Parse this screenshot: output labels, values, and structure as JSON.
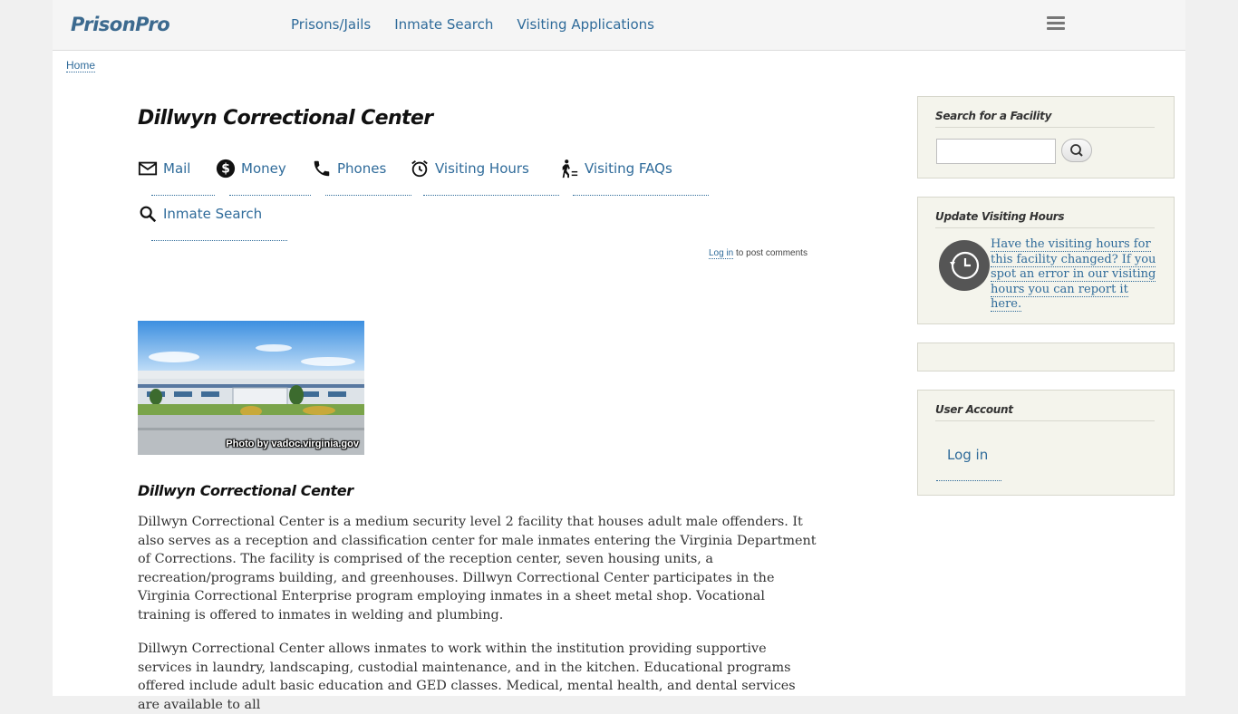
{
  "header": {
    "logo": "PrisonPro",
    "nav": [
      "Prisons/Jails",
      "Inmate Search",
      "Visiting Applications"
    ]
  },
  "breadcrumb": {
    "home": "Home"
  },
  "main": {
    "title": "Dillwyn Correctional Center",
    "quick_links": {
      "mail": "Mail",
      "money": "Money",
      "phones": "Phones",
      "visiting_hours": "Visiting Hours",
      "visiting_faqs": "Visiting FAQs",
      "inmate_search": "Inmate Search"
    },
    "login_note": {
      "link": "Log in",
      "rest": " to post comments"
    },
    "photo_caption": "Photo by vadoc.virginia.gov",
    "subheading": "Dillwyn Correctional Center",
    "paragraphs": [
      "Dillwyn Correctional Center is a medium security level 2 facility that houses adult male offenders.  It also serves as a reception and classification center for male inmates entering the Virginia Department of Corrections.  The facility is comprised of the reception center, seven housing units, a recreation/programs building, and greenhouses.  Dillwyn Correctional Center participates in the Virginia Correctional Enterprise program employing inmates in a sheet metal shop.  Vocational training is offered to inmates in welding and plumbing.",
      "Dillwyn Correctional Center allows inmates to work within the institution providing supportive services in laundry, landscaping, custodial maintenance, and in the kitchen.  Educational programs offered include adult basic education and GED classes.  Medical, mental health, and dental services are available to all"
    ]
  },
  "sidebar": {
    "search": {
      "title": "Search for a Facility",
      "value": ""
    },
    "update": {
      "title": "Update Visiting Hours",
      "link": "Have the visiting hours for this facility changed?  If you spot an error in our visiting hours you can report it here."
    },
    "account": {
      "title": "User Account",
      "login": "Log in"
    }
  },
  "colors": {
    "link": "#2f6b9a",
    "sidebar_bg": "#f4f4ec"
  },
  "icons": [
    "envelope-icon",
    "dollar-icon",
    "phone-icon",
    "alarm-clock-icon",
    "visitor-icon",
    "magnifier-icon",
    "history-clock-icon"
  ]
}
